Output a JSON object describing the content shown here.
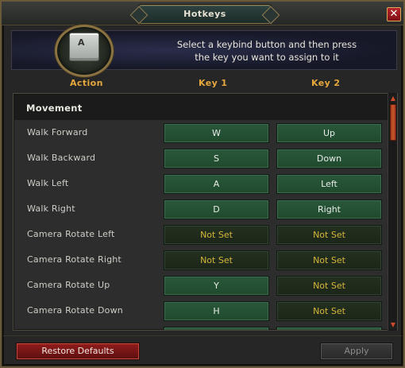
{
  "window": {
    "title": "Hotkeys",
    "close_glyph": "✕"
  },
  "banner": {
    "emblem_key": "A",
    "line1": "Select a keybind button and then press",
    "line2": "the key you want to assign to it"
  },
  "columns": {
    "action": "Action",
    "key1": "Key 1",
    "key2": "Key 2"
  },
  "section": {
    "title": "Movement"
  },
  "rows": [
    {
      "action": "Walk Forward",
      "key1": "W",
      "key2": "Up"
    },
    {
      "action": "Walk Backward",
      "key1": "S",
      "key2": "Down"
    },
    {
      "action": "Walk Left",
      "key1": "A",
      "key2": "Left"
    },
    {
      "action": "Walk Right",
      "key1": "D",
      "key2": "Right"
    },
    {
      "action": "Camera Rotate Left",
      "key1": "Not Set",
      "key2": "Not Set"
    },
    {
      "action": "Camera Rotate Right",
      "key1": "Not Set",
      "key2": "Not Set"
    },
    {
      "action": "Camera Rotate Up",
      "key1": "Y",
      "key2": "Not Set"
    },
    {
      "action": "Camera Rotate Down",
      "key1": "H",
      "key2": "Not Set"
    }
  ],
  "footer": {
    "restore_label": "Restore Defaults",
    "apply_label": "Apply"
  },
  "colors": {
    "accent": "#e6a73d",
    "set_button": "#2a573a",
    "unset_text": "#d6b53a",
    "danger_button": "#8f1c1c"
  }
}
